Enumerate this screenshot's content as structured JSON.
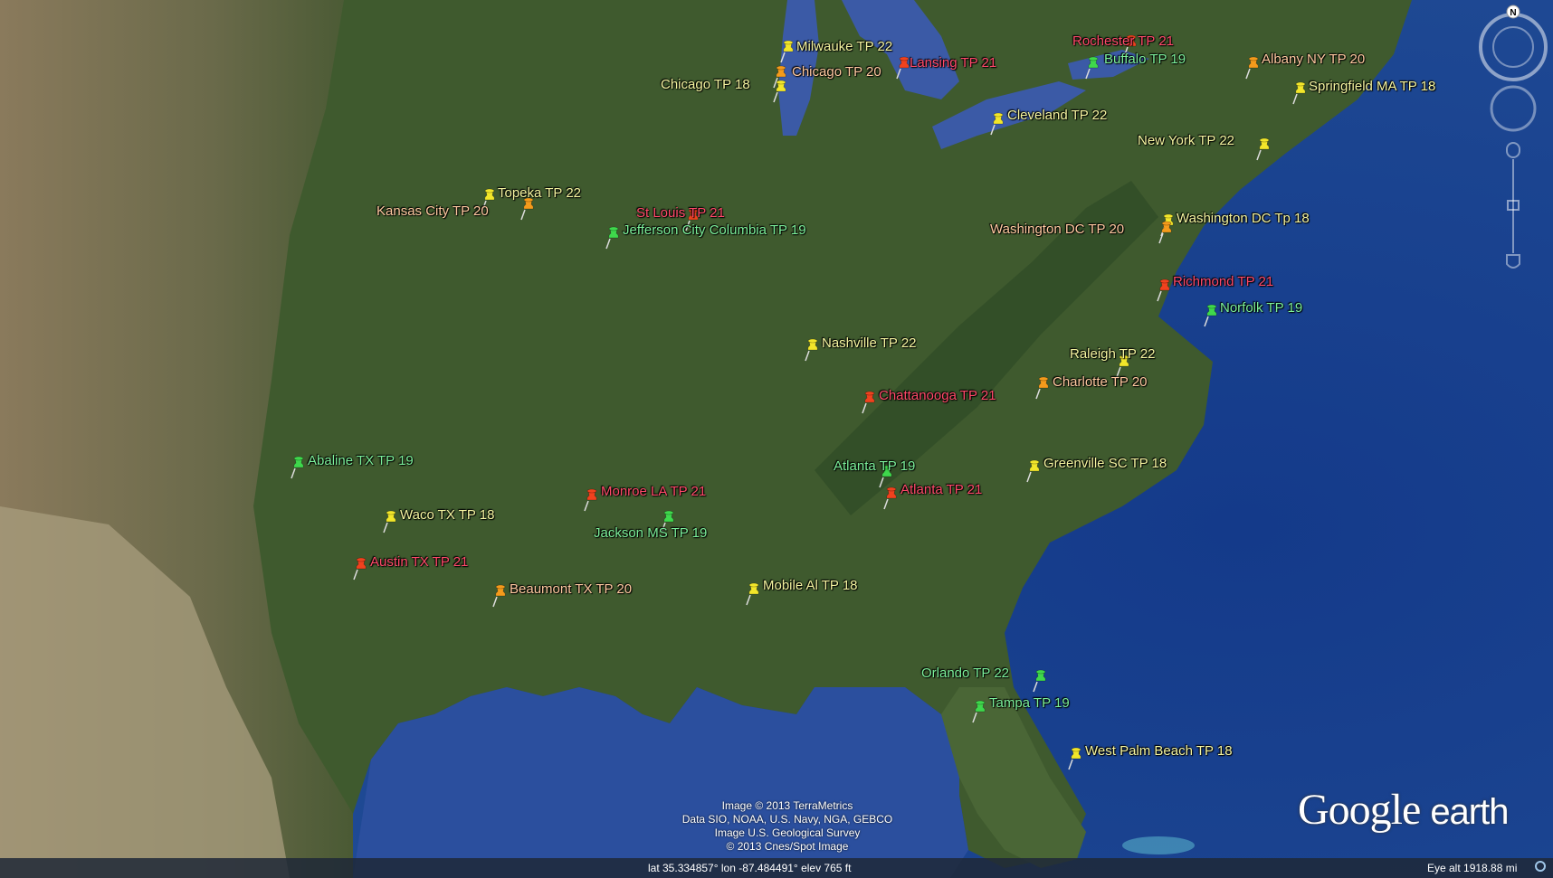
{
  "map": {
    "colors": {
      "ocean": "#1e3f82",
      "land": "#3d5a2c",
      "west": "#7b6e55",
      "lake": "#3b5aa6"
    },
    "pins": [
      {
        "name": "Milwauke TP 22",
        "color": "yellow"
      },
      {
        "name": "Chicago TP 20",
        "color": "orange"
      },
      {
        "name": "Chicago TP 18",
        "color": "yellow"
      },
      {
        "name": "Lansing TP 21",
        "color": "red"
      },
      {
        "name": "Rochester TP 21",
        "color": "red"
      },
      {
        "name": "Buffalo  TP 19",
        "color": "green"
      },
      {
        "name": "Albany NY TP 20",
        "color": "orange"
      },
      {
        "name": "Springfield MA TP 18",
        "color": "yellow"
      },
      {
        "name": "Cleveland TP 22",
        "color": "yellow"
      },
      {
        "name": "New York TP 22",
        "color": "yellow"
      },
      {
        "name": "Topeka TP 22",
        "color": "yellow"
      },
      {
        "name": "Kansas City TP 20",
        "color": "orange"
      },
      {
        "name": "St Louis TP 21",
        "color": "red"
      },
      {
        "name": "Jefferson City Columbia TP 19",
        "color": "green"
      },
      {
        "name": "Washington DC Tp 18",
        "color": "yellow"
      },
      {
        "name": "Washington DC TP 20",
        "color": "orange"
      },
      {
        "name": "Richmond TP 21",
        "color": "red"
      },
      {
        "name": "Norfolk TP 19",
        "color": "green"
      },
      {
        "name": "Nashville TP 22",
        "color": "yellow"
      },
      {
        "name": "Raleigh TP 22",
        "color": "yellow"
      },
      {
        "name": "Charlotte TP 20",
        "color": "orange"
      },
      {
        "name": "Chattanooga  TP 21",
        "color": "red"
      },
      {
        "name": "Abaline TX  TP 19",
        "color": "green"
      },
      {
        "name": "Atlanta TP 19",
        "color": "green"
      },
      {
        "name": "Atlanta TP 21",
        "color": "red"
      },
      {
        "name": "Greenville SC  TP 18",
        "color": "yellow"
      },
      {
        "name": "Monroe LA TP 21",
        "color": "red"
      },
      {
        "name": "Waco TX  TP 18",
        "color": "yellow"
      },
      {
        "name": "Jackson MS  TP 19",
        "color": "green"
      },
      {
        "name": "Austin TX TP 21",
        "color": "red"
      },
      {
        "name": "Beaumont TX TP 20",
        "color": "orange"
      },
      {
        "name": "Mobile Al TP 18",
        "color": "yellow"
      },
      {
        "name": "Orlando TP 22",
        "color": "green"
      },
      {
        "name": "Tampa TP 19",
        "color": "green"
      },
      {
        "name": "West Palm Beach  TP 18",
        "color": "yellow"
      }
    ]
  },
  "credits": [
    "Image © 2013 TerraMetrics",
    "Data SIO, NOAA, U.S. Navy, NGA, GEBCO",
    "Image U.S. Geological Survey",
    "© 2013 Cnes/Spot Image"
  ],
  "logo": {
    "google": "Google",
    "earth": "earth"
  },
  "status": {
    "coords": "lat   35.334857°  lon  -87.484491°  elev   765 ft",
    "eye_alt": "Eye alt  1918.88 mi"
  },
  "nav": {
    "north_label": "N"
  }
}
